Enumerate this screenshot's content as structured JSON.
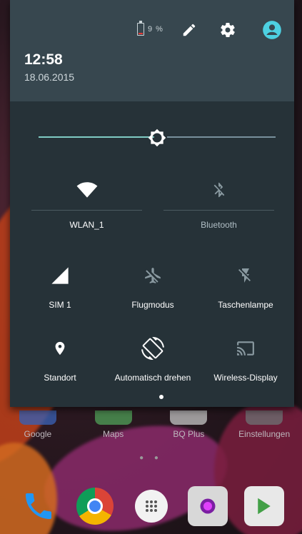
{
  "status": {
    "battery_text": "9 %",
    "battery_level": 0.09
  },
  "header": {
    "time": "12:58",
    "date": "18.06.2015"
  },
  "brightness": {
    "level": 0.5
  },
  "tiles_top": [
    {
      "label": "WLAN_1",
      "icon": "wifi-icon",
      "active": true
    },
    {
      "label": "Bluetooth",
      "icon": "bluetooth-off-icon",
      "active": false
    }
  ],
  "tiles_row2": [
    {
      "label": "SIM 1",
      "icon": "signal-icon"
    },
    {
      "label": "Flugmodus",
      "icon": "airplane-off-icon"
    },
    {
      "label": "Taschenlampe",
      "icon": "flashlight-off-icon"
    }
  ],
  "tiles_row3": [
    {
      "label": "Standort",
      "icon": "location-icon"
    },
    {
      "label": "Automatisch drehen",
      "icon": "auto-rotate-icon"
    },
    {
      "label": "Wireless-Display",
      "icon": "cast-icon"
    }
  ],
  "home": {
    "apps": [
      "Google",
      "Maps",
      "BQ Plus",
      "Einstellungen"
    ],
    "dock": [
      "phone-icon",
      "chrome-icon",
      "app-drawer-icon",
      "camera-icon",
      "play-store-icon"
    ]
  },
  "colors": {
    "shade_bg": "#263238",
    "header_bg": "#37474f",
    "accent": "#80cbc4",
    "user_icon": "#4dd0e1",
    "battery_low": "#e53935"
  }
}
